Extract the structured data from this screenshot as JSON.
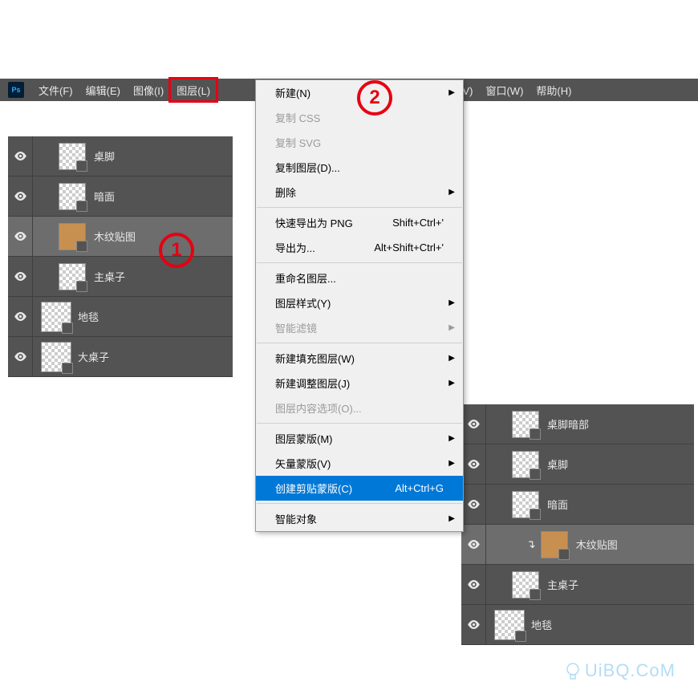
{
  "menubar": {
    "items": [
      "文件(F)",
      "编辑(E)",
      "图像(I)",
      "图层(L)",
      "",
      "视图(V)",
      "窗口(W)",
      "帮助(H)"
    ]
  },
  "leftPanel": {
    "layers": [
      {
        "name": "桌脚",
        "sel": false
      },
      {
        "name": "暗面",
        "sel": false
      },
      {
        "name": "木纹贴图",
        "sel": true,
        "wood": true
      },
      {
        "name": "主桌子",
        "sel": false
      },
      {
        "name": "地毯",
        "sel": false,
        "group": true
      },
      {
        "name": "大桌子",
        "sel": false,
        "group": true
      }
    ]
  },
  "rightPanel": {
    "layers": [
      {
        "name": "桌脚暗部",
        "sel": false
      },
      {
        "name": "桌脚",
        "sel": false
      },
      {
        "name": "暗面",
        "sel": false
      },
      {
        "name": "木纹贴图",
        "sel": true,
        "wood": true,
        "clip": true
      },
      {
        "name": "主桌子",
        "sel": false
      },
      {
        "name": "地毯",
        "sel": false,
        "group": true
      }
    ]
  },
  "dropdown": {
    "items": [
      {
        "t": "新建(N)",
        "sub": true
      },
      {
        "t": "复制 CSS",
        "dis": true
      },
      {
        "t": "复制 SVG",
        "dis": true
      },
      {
        "t": "复制图层(D)..."
      },
      {
        "t": "删除",
        "sub": true
      },
      {
        "sep": true
      },
      {
        "t": "快速导出为 PNG",
        "sc": "Shift+Ctrl+'"
      },
      {
        "t": "导出为...",
        "sc": "Alt+Shift+Ctrl+'"
      },
      {
        "sep": true
      },
      {
        "t": "重命名图层..."
      },
      {
        "t": "图层样式(Y)",
        "sub": true
      },
      {
        "t": "智能滤镜",
        "sub": true,
        "dis": true
      },
      {
        "sep": true
      },
      {
        "t": "新建填充图层(W)",
        "sub": true
      },
      {
        "t": "新建调整图层(J)",
        "sub": true
      },
      {
        "t": "图层内容选项(O)...",
        "dis": true
      },
      {
        "sep": true
      },
      {
        "t": "图层蒙版(M)",
        "sub": true
      },
      {
        "t": "矢量蒙版(V)",
        "sub": true
      },
      {
        "t": "创建剪贴蒙版(C)",
        "sc": "Alt+Ctrl+G",
        "sel": true
      },
      {
        "sep": true
      },
      {
        "t": "智能对象",
        "sub": true
      }
    ]
  },
  "annotations": {
    "n1": "1",
    "n2": "2"
  },
  "watermark": "UiBQ.CᴏM"
}
